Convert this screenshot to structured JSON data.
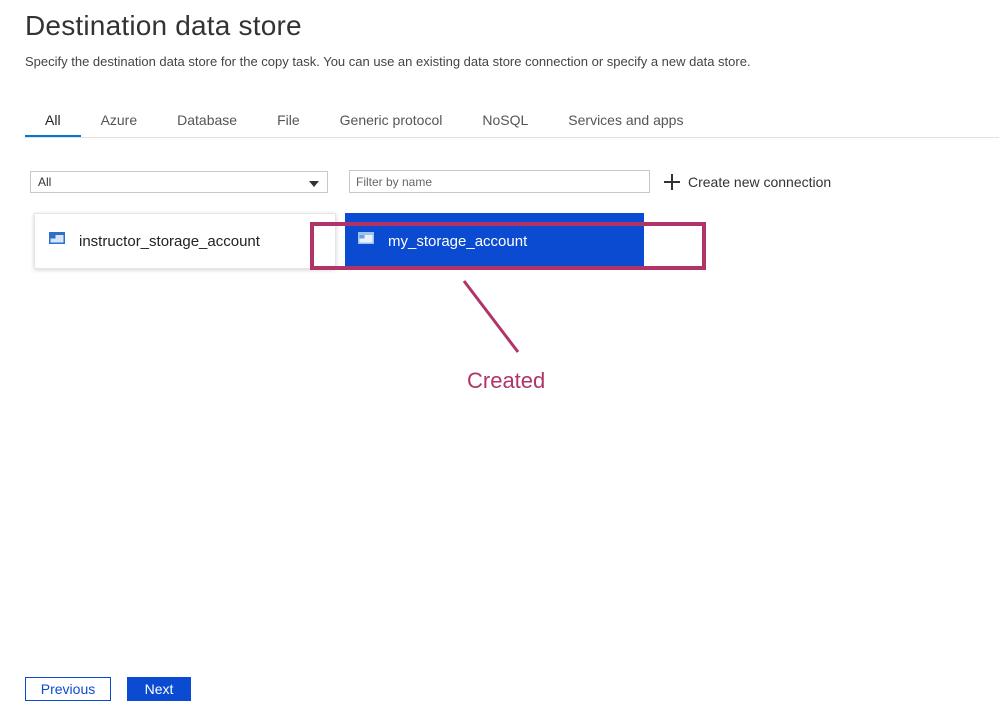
{
  "header": {
    "title": "Destination data store",
    "subtitle": "Specify the destination data store for the copy task. You can use an existing data store connection or specify a new data store."
  },
  "tabs": [
    {
      "label": "All",
      "active": true
    },
    {
      "label": "Azure",
      "active": false
    },
    {
      "label": "Database",
      "active": false
    },
    {
      "label": "File",
      "active": false
    },
    {
      "label": "Generic protocol",
      "active": false
    },
    {
      "label": "NoSQL",
      "active": false
    },
    {
      "label": "Services and apps",
      "active": false
    }
  ],
  "filters": {
    "type_select_value": "All",
    "name_filter_placeholder": "Filter by name",
    "name_filter_value": "",
    "create_new_label": "Create new connection"
  },
  "connections": [
    {
      "name": "instructor_storage_account",
      "selected": false,
      "icon": "storage-account-icon"
    },
    {
      "name": "my_storage_account",
      "selected": true,
      "icon": "storage-account-icon"
    }
  ],
  "annotation": {
    "label": "Created",
    "color": "#b03468"
  },
  "footer": {
    "previous_label": "Previous",
    "next_label": "Next"
  },
  "colors": {
    "accent": "#0b4bd1",
    "tab_underline": "#0078d4"
  }
}
